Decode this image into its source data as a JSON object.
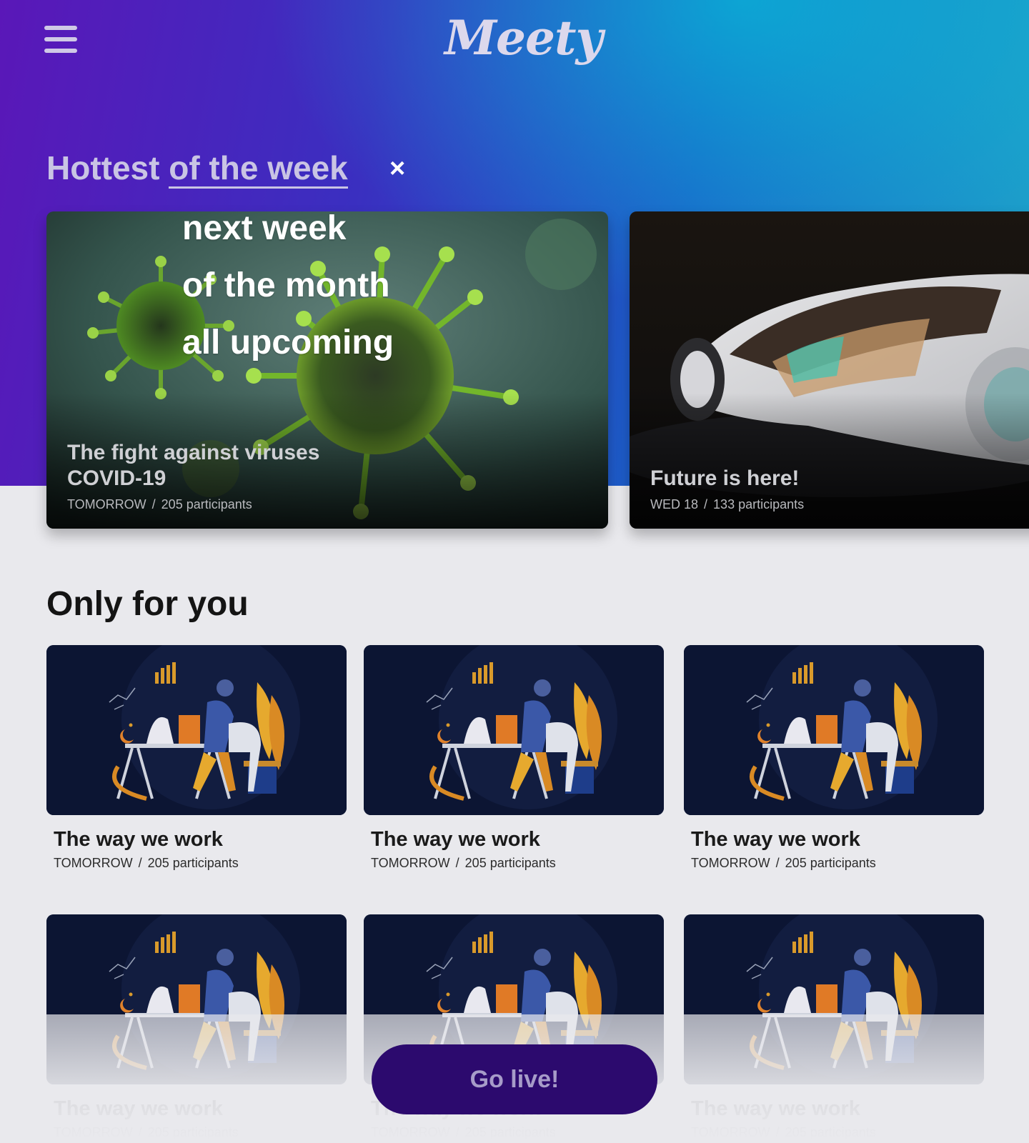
{
  "header": {
    "logo_text": "Meety",
    "menu_icon": "hamburger-menu-icon"
  },
  "hottest": {
    "title_prefix": "Hottest",
    "selected_period": "of the week",
    "close_icon": "close-icon",
    "close_glyph": "×",
    "period_options": [
      "next week",
      "of the month",
      "all upcoming"
    ]
  },
  "featured": [
    {
      "title_line1": "The fight against viruses",
      "title_line2": "COVID-19",
      "when": "TOMORROW",
      "participants": "205 participants",
      "image": "virus-image"
    },
    {
      "title_line1": "Future is here!",
      "when": "WED 18",
      "participants": "133 participants",
      "image": "concept-car-image"
    }
  ],
  "only_for_you": {
    "title": "Only for you",
    "items": [
      {
        "title": "The way we work",
        "when": "TOMORROW",
        "participants": "205 participants"
      },
      {
        "title": "The way we work",
        "when": "TOMORROW",
        "participants": "205 participants"
      },
      {
        "title": "The way we work",
        "when": "TOMORROW",
        "participants": "205 participants"
      },
      {
        "title": "The way we work",
        "when": "TOMORROW",
        "participants": "205 participants"
      },
      {
        "title": "The way we work",
        "when": "TOMORROW",
        "participants": "205 participants"
      },
      {
        "title": "The way we work",
        "when": "TOMORROW",
        "participants": "205 participants"
      }
    ]
  },
  "cta": {
    "label": "Go live!"
  },
  "meta_separator": "/",
  "colors": {
    "header_gradient_start": "#5a17b8",
    "header_gradient_end": "#1ea3c9",
    "cta_background": "#2c0a6e",
    "tile_background": "#0c1533"
  }
}
